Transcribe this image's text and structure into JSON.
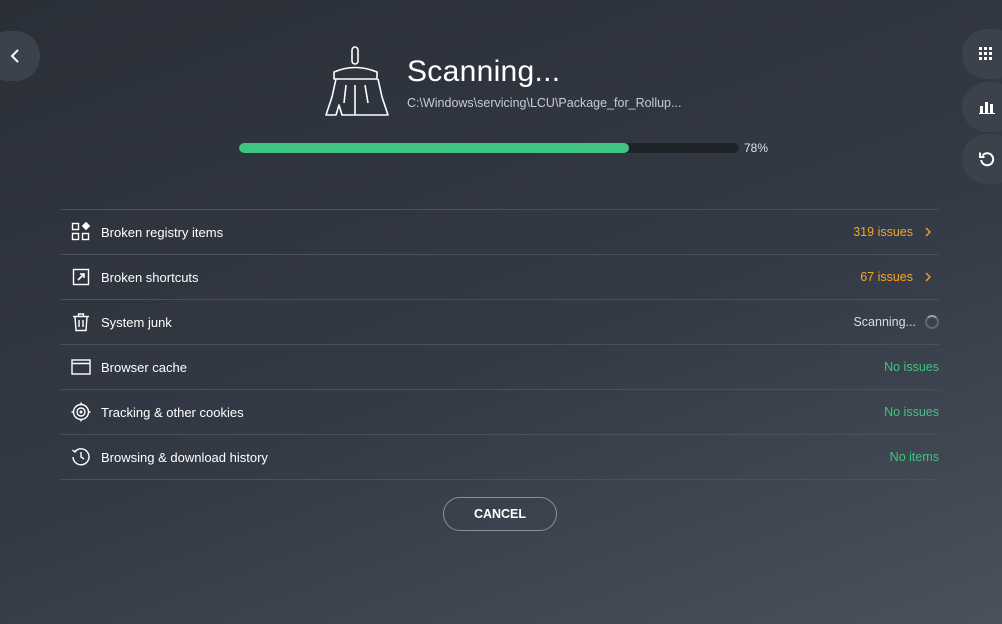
{
  "header": {
    "title": "Scanning...",
    "path": "C:\\Windows\\servicing\\LCU\\Package_for_Rollup...",
    "progress": 0.78,
    "progress_label": "78%"
  },
  "nav": {
    "back_icon": "chevron-left-icon",
    "right_icons": [
      "apps-grid-icon",
      "bar-chart-icon",
      "history-icon"
    ]
  },
  "rows": [
    {
      "label": "Broken registry items",
      "status": "319 issues",
      "status_type": "warning",
      "icon": "registry-icon"
    },
    {
      "label": "Broken shortcuts",
      "status": "67 issues",
      "status_type": "warning",
      "icon": "shortcut-icon"
    },
    {
      "label": "System junk",
      "status": "Scanning...",
      "status_type": "scanning",
      "icon": "trash-icon"
    },
    {
      "label": "Browser cache",
      "status": "No issues",
      "status_type": "ok",
      "icon": "browser-window-icon"
    },
    {
      "label": "Tracking & other cookies",
      "status": "No issues",
      "status_type": "ok",
      "icon": "target-icon"
    },
    {
      "label": "Browsing & download history",
      "status": "No items",
      "status_type": "ok",
      "icon": "clock-history-icon"
    }
  ],
  "actions": {
    "cancel_label": "CANCEL"
  },
  "colors": {
    "accent_green": "#3fc57f",
    "warning_orange": "#f0a52a",
    "background": "#2f343d"
  }
}
